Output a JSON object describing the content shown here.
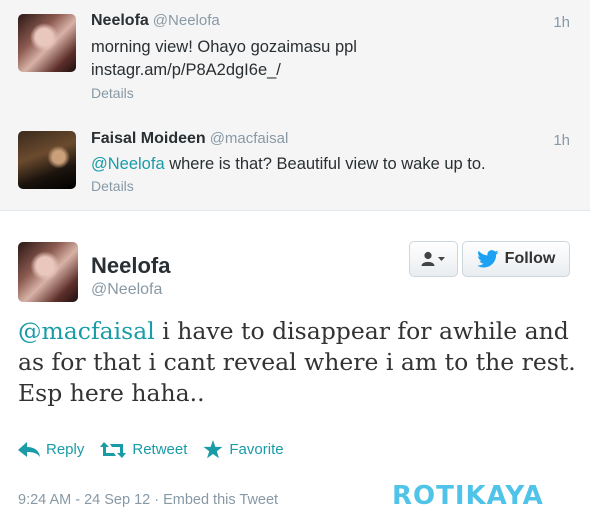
{
  "context_tweets": [
    {
      "name": "Neelofa",
      "handle": "@Neelofa",
      "time": "1h",
      "text": "morning view! Ohayo gozaimasu ppl",
      "link": "instagr.am/p/P8A2dgI6e_/",
      "details": "Details"
    },
    {
      "name": "Faisal Moideen",
      "handle": "@macfaisal",
      "time": "1h",
      "mention": "@Neelofa",
      "text": " where is that? Beautiful view to wake up to.",
      "details": "Details"
    }
  ],
  "main_tweet": {
    "name": "Neelofa",
    "handle": "@Neelofa",
    "mention": "@macfaisal",
    "text": " i have to disappear for awhile and as for that i cant reveal where i am to the rest. Esp here haha..",
    "follow_label": "Follow",
    "actions": {
      "reply": "Reply",
      "retweet": "Retweet",
      "favorite": "Favorite"
    },
    "meta": "9:24 AM - 24 Sep 12 · Embed this Tweet"
  },
  "watermark": "ROTIKAYA",
  "colors": {
    "link": "#1a9ba8",
    "muted": "#8899a6",
    "twitter_blue": "#1da1f2",
    "watermark": "#4fc3e8"
  },
  "icons": [
    "person-icon",
    "caret-down-icon",
    "twitter-bird-icon",
    "reply-arrow-icon",
    "retweet-icon",
    "star-icon"
  ]
}
